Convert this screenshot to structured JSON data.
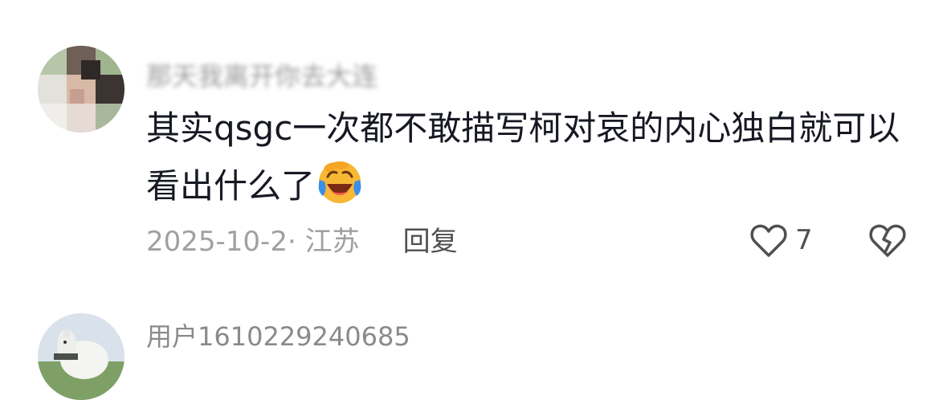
{
  "comments": [
    {
      "username": "那天我离开你去大连",
      "text": "其实qsgc一次都不敢描写柯对哀的内心独白就可以看出什么了",
      "emoji_icon": "laughing-crying-emoji-icon",
      "date_location": "2025-10-2· 江苏",
      "reply_label": "回复",
      "like_count": "7",
      "like_icon": "heart-outline-icon",
      "dislike_icon": "broken-heart-icon"
    },
    {
      "username": "用户1610229240685"
    }
  ],
  "colors": {
    "text_primary": "#161823",
    "text_secondary": "#8a8a8a",
    "meta_gray": "#a0a0a0",
    "icon_gray": "#505050",
    "emoji_face": "#f8b836",
    "emoji_tears": "#3b8fe8"
  }
}
